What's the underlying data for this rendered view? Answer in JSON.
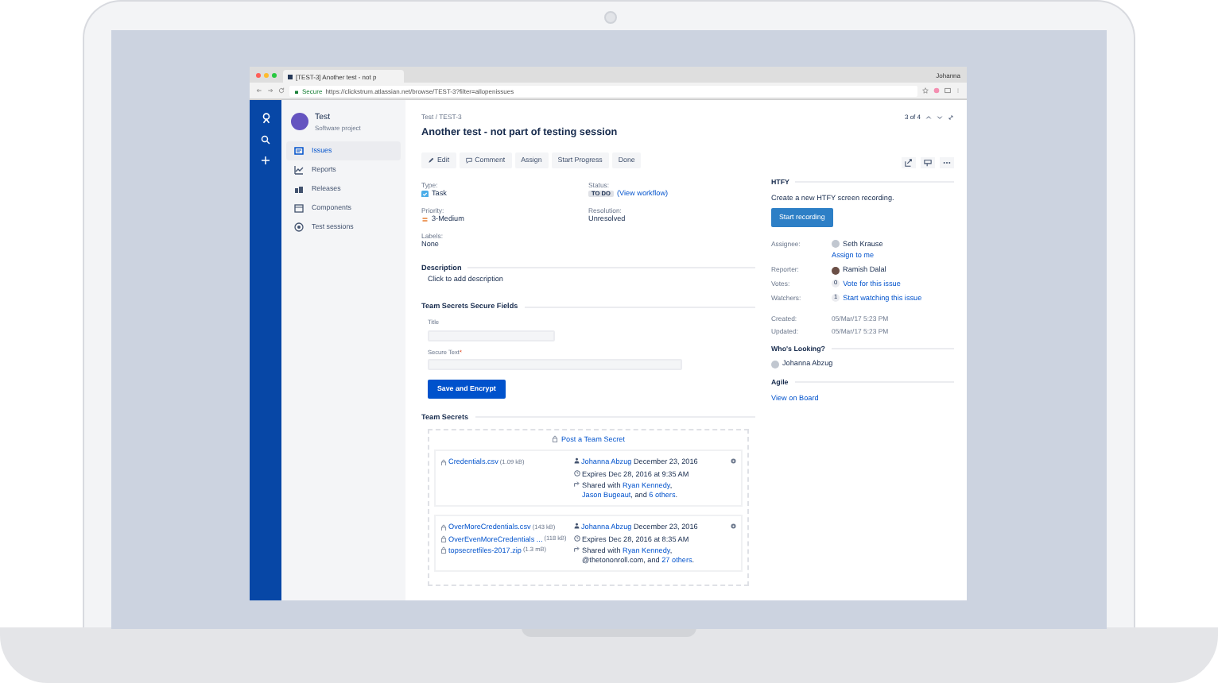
{
  "browser": {
    "tab_title": "[TEST-3] Another test - not p",
    "user": "Johanna",
    "secure_label": "Secure",
    "url": "https://clickstrum.atlassian.net/browse/TEST-3?filter=allopenissues"
  },
  "project": {
    "name": "Test",
    "type": "Software project"
  },
  "nav": [
    {
      "label": "Issues",
      "selected": true,
      "kind": "issues"
    },
    {
      "label": "Reports",
      "selected": false,
      "kind": "reports"
    },
    {
      "label": "Releases",
      "selected": false,
      "kind": "releases"
    },
    {
      "label": "Components",
      "selected": false,
      "kind": "components"
    },
    {
      "label": "Test sessions",
      "selected": false,
      "kind": "sessions"
    }
  ],
  "issue": {
    "breadcrumb": "Test / TEST-3",
    "pager": "3 of 4",
    "title": "Another test - not part of testing session"
  },
  "actions": [
    {
      "label": "Edit",
      "kind": "edit"
    },
    {
      "label": "Comment",
      "kind": "comment"
    },
    {
      "label": "Assign",
      "kind": "plain"
    },
    {
      "label": "Start Progress",
      "kind": "plain"
    },
    {
      "label": "Done",
      "kind": "plain"
    }
  ],
  "fields": [
    {
      "label": "Type:",
      "value": "Task",
      "kind": "type"
    },
    {
      "label": "Status:",
      "value": "TO DO",
      "link": "(View workflow)",
      "kind": "status"
    },
    {
      "label": "Priority:",
      "value": "3-Medium",
      "kind": "priority"
    },
    {
      "label": "Resolution:",
      "value": "Unresolved",
      "kind": "plain"
    },
    {
      "label": "Labels:",
      "value": "None",
      "kind": "plain"
    }
  ],
  "description": {
    "heading": "Description",
    "text": "Click to add description"
  },
  "secure_form": {
    "heading": "Team Secrets Secure Fields",
    "fields": [
      {
        "label": "Title",
        "kind": "short"
      },
      {
        "label": "Secure Text",
        "required_mark": "*",
        "kind": "long"
      }
    ],
    "button": "Save and Encrypt"
  },
  "secrets": {
    "heading": "Team Secrets",
    "post": "Post a Team Secret",
    "items": [
      {
        "files": [
          {
            "name": "Credentials.csv",
            "size": "(1.09 kB)"
          }
        ],
        "author": "Johanna Abzug",
        "date": "December 23, 2016",
        "expires": "Expires Dec 28, 2016 at 9:35 AM",
        "shared": [
          {
            "text": "Shared with ",
            "kind": "text"
          },
          {
            "text": "Ryan Kennedy",
            "kind": "link"
          },
          {
            "text": ", ",
            "kind": "text"
          },
          {
            "text": "Jason Bugeaut",
            "kind": "link"
          },
          {
            "text": ", and ",
            "kind": "text"
          },
          {
            "text": "6 others",
            "kind": "link"
          },
          {
            "text": ".",
            "kind": "text"
          }
        ]
      },
      {
        "files": [
          {
            "name": "OverMoreCredentials.csv",
            "size": "(143 kB)"
          },
          {
            "name": "OverEvenMoreCredentials ...",
            "size": "(118 kB)"
          },
          {
            "name": "topsecretfiles-2017.zip",
            "size": "(1.3 mB)"
          }
        ],
        "author": "Johanna Abzug",
        "date": "December 23, 2016",
        "expires": "Expires Dec 28, 2016 at 8:35 AM",
        "shared": [
          {
            "text": "Shared with ",
            "kind": "text"
          },
          {
            "text": "Ryan Kennedy",
            "kind": "link"
          },
          {
            "text": ", @thetononroll.com, and ",
            "kind": "text"
          },
          {
            "text": "27 others",
            "kind": "link"
          },
          {
            "text": ".",
            "kind": "text"
          }
        ]
      }
    ]
  },
  "htfy": {
    "heading": "HTFY",
    "text": "Create a new HTFY screen recording.",
    "button": "Start recording"
  },
  "people": [
    {
      "label": "Assignee:",
      "kind": "avatar",
      "value": "Seth Krause",
      "link": "Assign to me"
    },
    {
      "label": "Reporter:",
      "kind": "photo",
      "value": "Ramish Dalal"
    },
    {
      "label": "Votes:",
      "kind": "count",
      "count": "0",
      "link": "Vote for this issue"
    },
    {
      "label": "Watchers:",
      "kind": "count",
      "count": "1",
      "link": "Start watching this issue"
    }
  ],
  "dates": [
    {
      "label": "Created:",
      "value": "05/Mar/17 5:23 PM"
    },
    {
      "label": "Updated:",
      "value": "05/Mar/17 5:23 PM"
    }
  ],
  "looking": {
    "heading": "Who's Looking?",
    "people": [
      "Johanna Abzug"
    ]
  },
  "agile": {
    "heading": "Agile",
    "link": "View on Board"
  }
}
